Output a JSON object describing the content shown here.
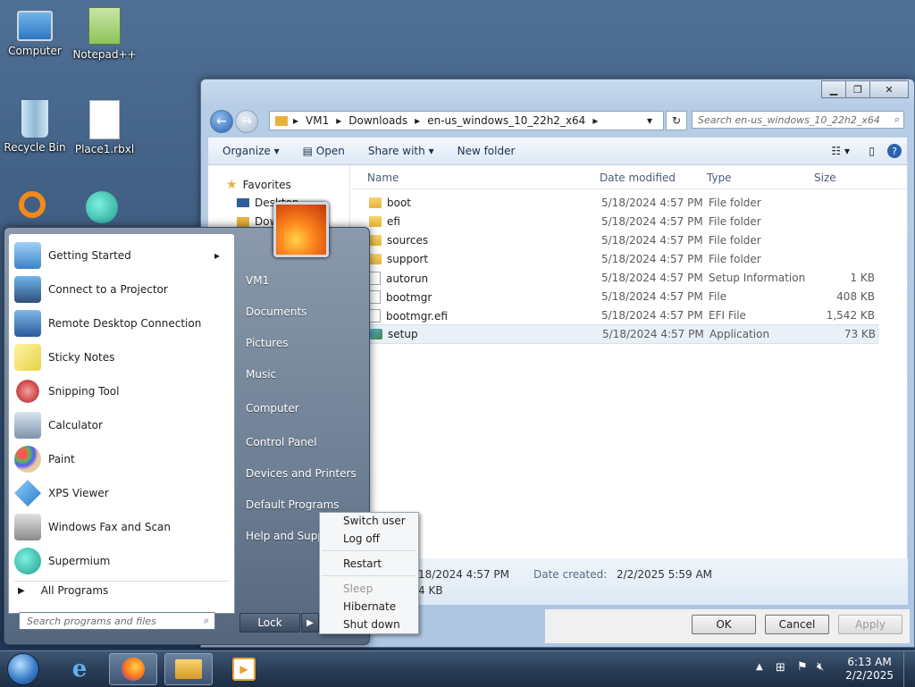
{
  "desktop_icons": [
    {
      "label": "Computer"
    },
    {
      "label": "Notepad++"
    },
    {
      "label": "Recycle Bin"
    },
    {
      "label": "Place1.rbxl"
    }
  ],
  "explorer": {
    "breadcrumb": [
      "VM1",
      "Downloads",
      "en-us_windows_10_22h2_x64"
    ],
    "search_placeholder": "Search en-us_windows_10_22h2_x64",
    "toolbar": {
      "organize": "Organize",
      "open": "Open",
      "share_with": "Share with",
      "new_folder": "New folder"
    },
    "nav": {
      "favorites": "Favorites",
      "desktop": "Desktop",
      "downloads": "Dow"
    },
    "columns": {
      "name": "Name",
      "date": "Date modified",
      "type": "Type",
      "size": "Size"
    },
    "files": [
      {
        "name": "boot",
        "date": "5/18/2024 4:57 PM",
        "type": "File folder",
        "size": "",
        "kind": "folder"
      },
      {
        "name": "efi",
        "date": "5/18/2024 4:57 PM",
        "type": "File folder",
        "size": "",
        "kind": "folder"
      },
      {
        "name": "sources",
        "date": "5/18/2024 4:57 PM",
        "type": "File folder",
        "size": "",
        "kind": "folder"
      },
      {
        "name": "support",
        "date": "5/18/2024 4:57 PM",
        "type": "File folder",
        "size": "",
        "kind": "folder"
      },
      {
        "name": "autorun",
        "date": "5/18/2024 4:57 PM",
        "type": "Setup Information",
        "size": "1 KB",
        "kind": "doc"
      },
      {
        "name": "bootmgr",
        "date": "5/18/2024 4:57 PM",
        "type": "File",
        "size": "408 KB",
        "kind": "doc"
      },
      {
        "name": "bootmgr.efi",
        "date": "5/18/2024 4:57 PM",
        "type": "EFI File",
        "size": "1,542 KB",
        "kind": "doc"
      },
      {
        "name": "setup",
        "date": "5/18/2024 4:57 PM",
        "type": "Application",
        "size": "73 KB",
        "kind": "app"
      }
    ],
    "details": {
      "modified": "18/2024 4:57 PM",
      "created_label": "Date created:",
      "created_value": "2/2/2025 5:59 AM",
      "size": "4 KB"
    },
    "dialog": {
      "ok": "OK",
      "cancel": "Cancel",
      "apply": "Apply"
    }
  },
  "start_menu": {
    "programs": [
      {
        "label": "Getting Started",
        "arrow": "▸"
      },
      {
        "label": "Connect to a Projector"
      },
      {
        "label": "Remote Desktop Connection"
      },
      {
        "label": "Sticky Notes"
      },
      {
        "label": "Snipping Tool"
      },
      {
        "label": "Calculator"
      },
      {
        "label": "Paint"
      },
      {
        "label": "XPS Viewer"
      },
      {
        "label": "Windows Fax and Scan"
      },
      {
        "label": "Supermium"
      }
    ],
    "all_programs": "All Programs",
    "search_placeholder": "Search programs and files",
    "right_items": [
      "VM1",
      "Documents",
      "Pictures",
      "Music",
      "Computer",
      "Control Panel",
      "Devices and Printers",
      "Default Programs",
      "Help and Support"
    ],
    "lock": "Lock"
  },
  "power_menu": {
    "switch_user": "Switch user",
    "log_off": "Log off",
    "restart": "Restart",
    "sleep": "Sleep",
    "hibernate": "Hibernate",
    "shut_down": "Shut down"
  },
  "taskbar": {
    "time": "6:13 AM",
    "date": "2/2/2025"
  }
}
